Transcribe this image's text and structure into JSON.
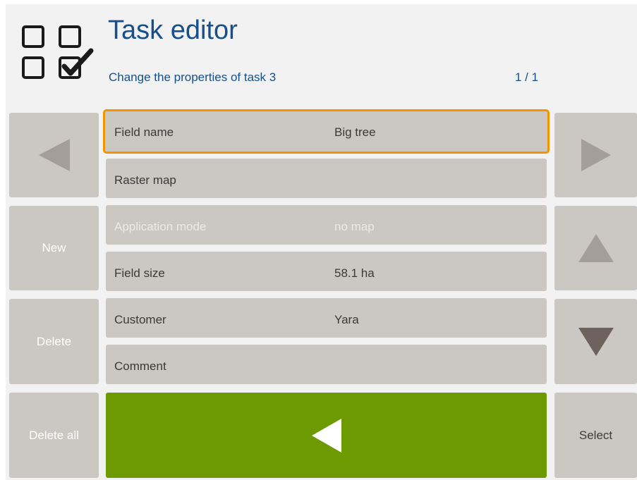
{
  "header": {
    "title": "Task editor",
    "subtitle": "Change the properties of task 3",
    "pager": "1 / 1",
    "app_icon": "task-checklist-icon"
  },
  "side_left": {
    "prev_icon": "arrow-left-icon",
    "new_label": "New",
    "delete_label": "Delete",
    "delete_all_label": "Delete all"
  },
  "side_right": {
    "next_icon": "arrow-right-icon",
    "up_icon": "arrow-up-icon",
    "down_icon": "arrow-down-icon",
    "select_label": "Select"
  },
  "fields": [
    {
      "label": "Field name",
      "value": "Big tree",
      "selected": true,
      "enabled": true
    },
    {
      "label": "Raster map",
      "value": "",
      "selected": false,
      "enabled": true
    },
    {
      "label": "Application mode",
      "value": "no map",
      "selected": false,
      "enabled": false
    },
    {
      "label": "Field size",
      "value": "58.1 ha",
      "selected": false,
      "enabled": true
    },
    {
      "label": "Customer",
      "value": "Yara",
      "selected": false,
      "enabled": true
    },
    {
      "label": "Comment",
      "value": "",
      "selected": false,
      "enabled": true
    }
  ],
  "back_button": {
    "icon": "back-arrow-icon"
  },
  "colors": {
    "title_blue": "#164f8a",
    "accent_orange": "#f29400",
    "confirm_green": "#6c9a00",
    "button_grey": "#cbc7c2",
    "disabled_arrow": "#a49e98",
    "enabled_arrow": "#6e625c"
  }
}
